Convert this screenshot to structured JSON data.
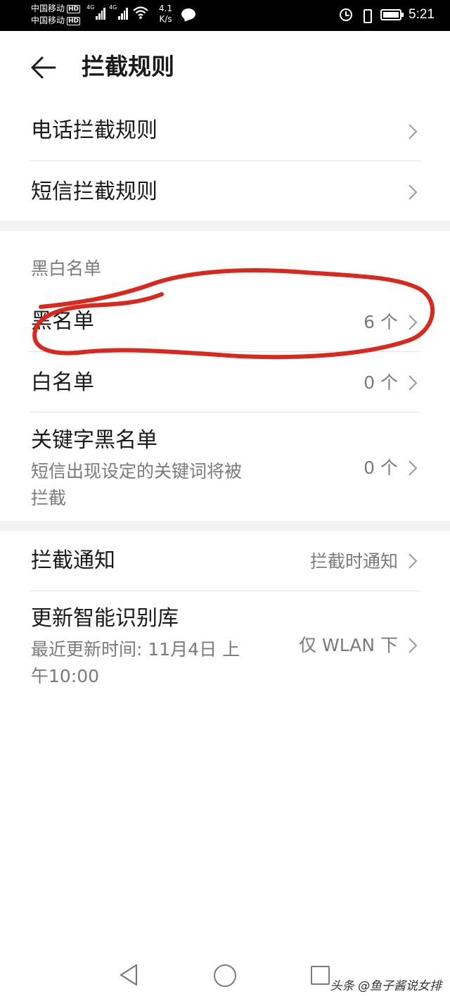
{
  "status_bar": {
    "carrier_1": "中国移动",
    "carrier_2": "中国移动",
    "hd_badge": "HD",
    "network_1": "4G",
    "network_2": "4G",
    "speed_value": "4.1",
    "speed_unit": "K/s",
    "time": "5:21",
    "icons": [
      "signal-icon",
      "wifi-icon",
      "message-bubble-icon",
      "alarm-icon",
      "vibrate-icon",
      "battery-icon"
    ]
  },
  "header": {
    "title": "拦截规则"
  },
  "rules": {
    "items": [
      {
        "label": "电话拦截规则"
      },
      {
        "label": "短信拦截规则"
      }
    ]
  },
  "lists": {
    "section_title": "黑白名单",
    "blacklist": {
      "label": "黑名单",
      "value": "6 个"
    },
    "whitelist": {
      "label": "白名单",
      "value": "0 个"
    },
    "keyword_blacklist": {
      "label": "关键字黑名单",
      "description_1": "短信出现设定的关键词将被",
      "description_2": "拦截",
      "value": "0 个"
    }
  },
  "settings": {
    "notification": {
      "label": "拦截通知",
      "value": "拦截时通知"
    },
    "update_library": {
      "label": "更新智能识别库",
      "description_1": "最近更新时间: 11月4日 上",
      "description_2": "午10:00",
      "value": "仅 WLAN 下"
    }
  },
  "annotation": {
    "color": "#d9281e"
  },
  "nav": {
    "watermark": "头条 @鱼子酱说女排"
  },
  "colors": {
    "text_primary": "#1a1a1a",
    "text_secondary": "#7a7a7a",
    "section_gap": "#f3f3f3"
  }
}
